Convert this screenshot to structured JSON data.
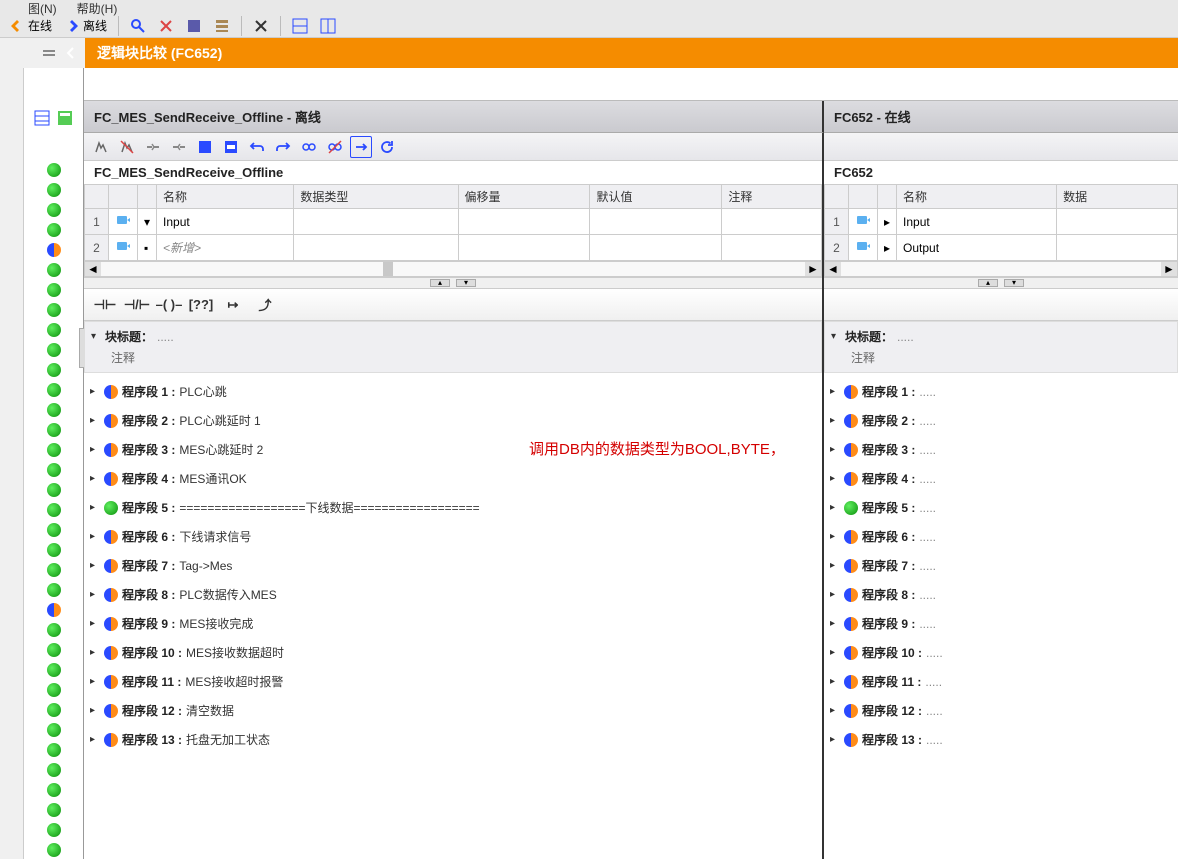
{
  "menu_fragments": [
    "图(N)",
    "帮助(H)"
  ],
  "toolbar": {
    "online_label": "在线",
    "offline_label": "离线"
  },
  "title_bar": "逻辑块比较 (FC652)",
  "left_pane_title": "FC_MES_SendReceive_Offline  - 离线",
  "right_pane_title": "FC652 - 在线",
  "left_block_name": "FC_MES_SendReceive_Offline",
  "right_block_name": "FC652",
  "var_cols": {
    "name": "名称",
    "dtype": "数据类型",
    "offset": "偏移量",
    "default": "默认值",
    "comment": "注释"
  },
  "var_cols_r": {
    "name": "名称",
    "dtype": "数据"
  },
  "left_vars": [
    {
      "n": "1",
      "name": "Input",
      "expand": true
    },
    {
      "n": "2",
      "name": "<新增>",
      "addnew": true
    }
  ],
  "right_vars": [
    {
      "n": "1",
      "name": "Input"
    },
    {
      "n": "2",
      "name": "Output"
    }
  ],
  "block_title_label": "块标题：",
  "comment_label": "注释",
  "dots": ".....",
  "annotation_text": "调用DB内的数据类型为BOOL,BYTE，",
  "left_networks": [
    {
      "n": 1,
      "status": "split",
      "title": "PLC心跳"
    },
    {
      "n": 2,
      "status": "split",
      "title": "PLC心跳延时 1"
    },
    {
      "n": 3,
      "status": "split",
      "title": "MES心跳延时 2"
    },
    {
      "n": 4,
      "status": "split",
      "title": "MES通讯OK"
    },
    {
      "n": 5,
      "status": "green",
      "title": "==================下线数据=================="
    },
    {
      "n": 6,
      "status": "split",
      "title": "下线请求信号"
    },
    {
      "n": 7,
      "status": "split",
      "title": "Tag->Mes"
    },
    {
      "n": 8,
      "status": "split",
      "title": "PLC数据传入MES"
    },
    {
      "n": 9,
      "status": "split",
      "title": "MES接收完成"
    },
    {
      "n": 10,
      "status": "split",
      "title": "MES接收数据超时"
    },
    {
      "n": 11,
      "status": "split",
      "title": "MES接收超时报警"
    },
    {
      "n": 12,
      "status": "split",
      "title": "清空数据"
    },
    {
      "n": 13,
      "status": "split",
      "title": "托盘无加工状态"
    }
  ],
  "right_networks": [
    {
      "n": 1,
      "status": "split"
    },
    {
      "n": 2,
      "status": "split"
    },
    {
      "n": 3,
      "status": "split"
    },
    {
      "n": 4,
      "status": "split"
    },
    {
      "n": 5,
      "status": "green"
    },
    {
      "n": 6,
      "status": "split"
    },
    {
      "n": 7,
      "status": "split"
    },
    {
      "n": 8,
      "status": "split"
    },
    {
      "n": 9,
      "status": "split"
    },
    {
      "n": 10,
      "status": "split"
    },
    {
      "n": 11,
      "status": "split"
    },
    {
      "n": 12,
      "status": "split"
    },
    {
      "n": 13,
      "status": "split"
    }
  ],
  "network_prefix": "程序段 ",
  "status_dots": [
    "green",
    "green",
    "green",
    "green",
    "split",
    "green",
    "green",
    "green",
    "green",
    "green",
    "green",
    "green",
    "green",
    "green",
    "green",
    "green",
    "green",
    "green",
    "green",
    "green",
    "green",
    "green",
    "split",
    "green",
    "green",
    "green",
    "green",
    "green",
    "green",
    "green",
    "green",
    "green",
    "green",
    "green",
    "green"
  ]
}
